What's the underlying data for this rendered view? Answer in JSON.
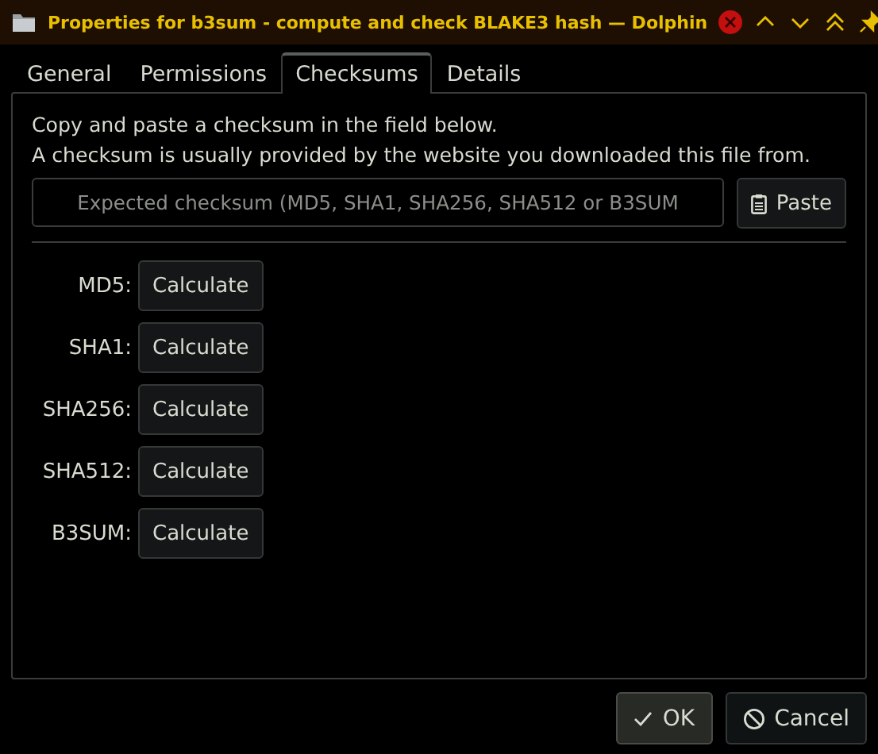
{
  "window": {
    "title": "Properties for b3sum - compute and check BLAKE3 hash — Dolphin"
  },
  "tabs": [
    {
      "label": "General",
      "selected": false
    },
    {
      "label": "Permissions",
      "selected": false
    },
    {
      "label": "Checksums",
      "selected": true
    },
    {
      "label": "Details",
      "selected": false
    }
  ],
  "intro": [
    "Copy and paste a checksum in the field below.",
    "A checksum is usually provided by the website you downloaded this file from."
  ],
  "checksum_field": {
    "placeholder": "Expected checksum (MD5, SHA1, SHA256, SHA512 or B3SUM"
  },
  "paste_button": "Paste",
  "algorithms": [
    {
      "label": "MD5:",
      "button": "Calculate"
    },
    {
      "label": "SHA1:",
      "button": "Calculate"
    },
    {
      "label": "SHA256:",
      "button": "Calculate"
    },
    {
      "label": "SHA512:",
      "button": "Calculate"
    },
    {
      "label": "B3SUM:",
      "button": "Calculate"
    }
  ],
  "buttons": [
    {
      "kind": "ok",
      "label": "OK"
    },
    {
      "kind": "cancel",
      "label": "Cancel"
    }
  ]
}
